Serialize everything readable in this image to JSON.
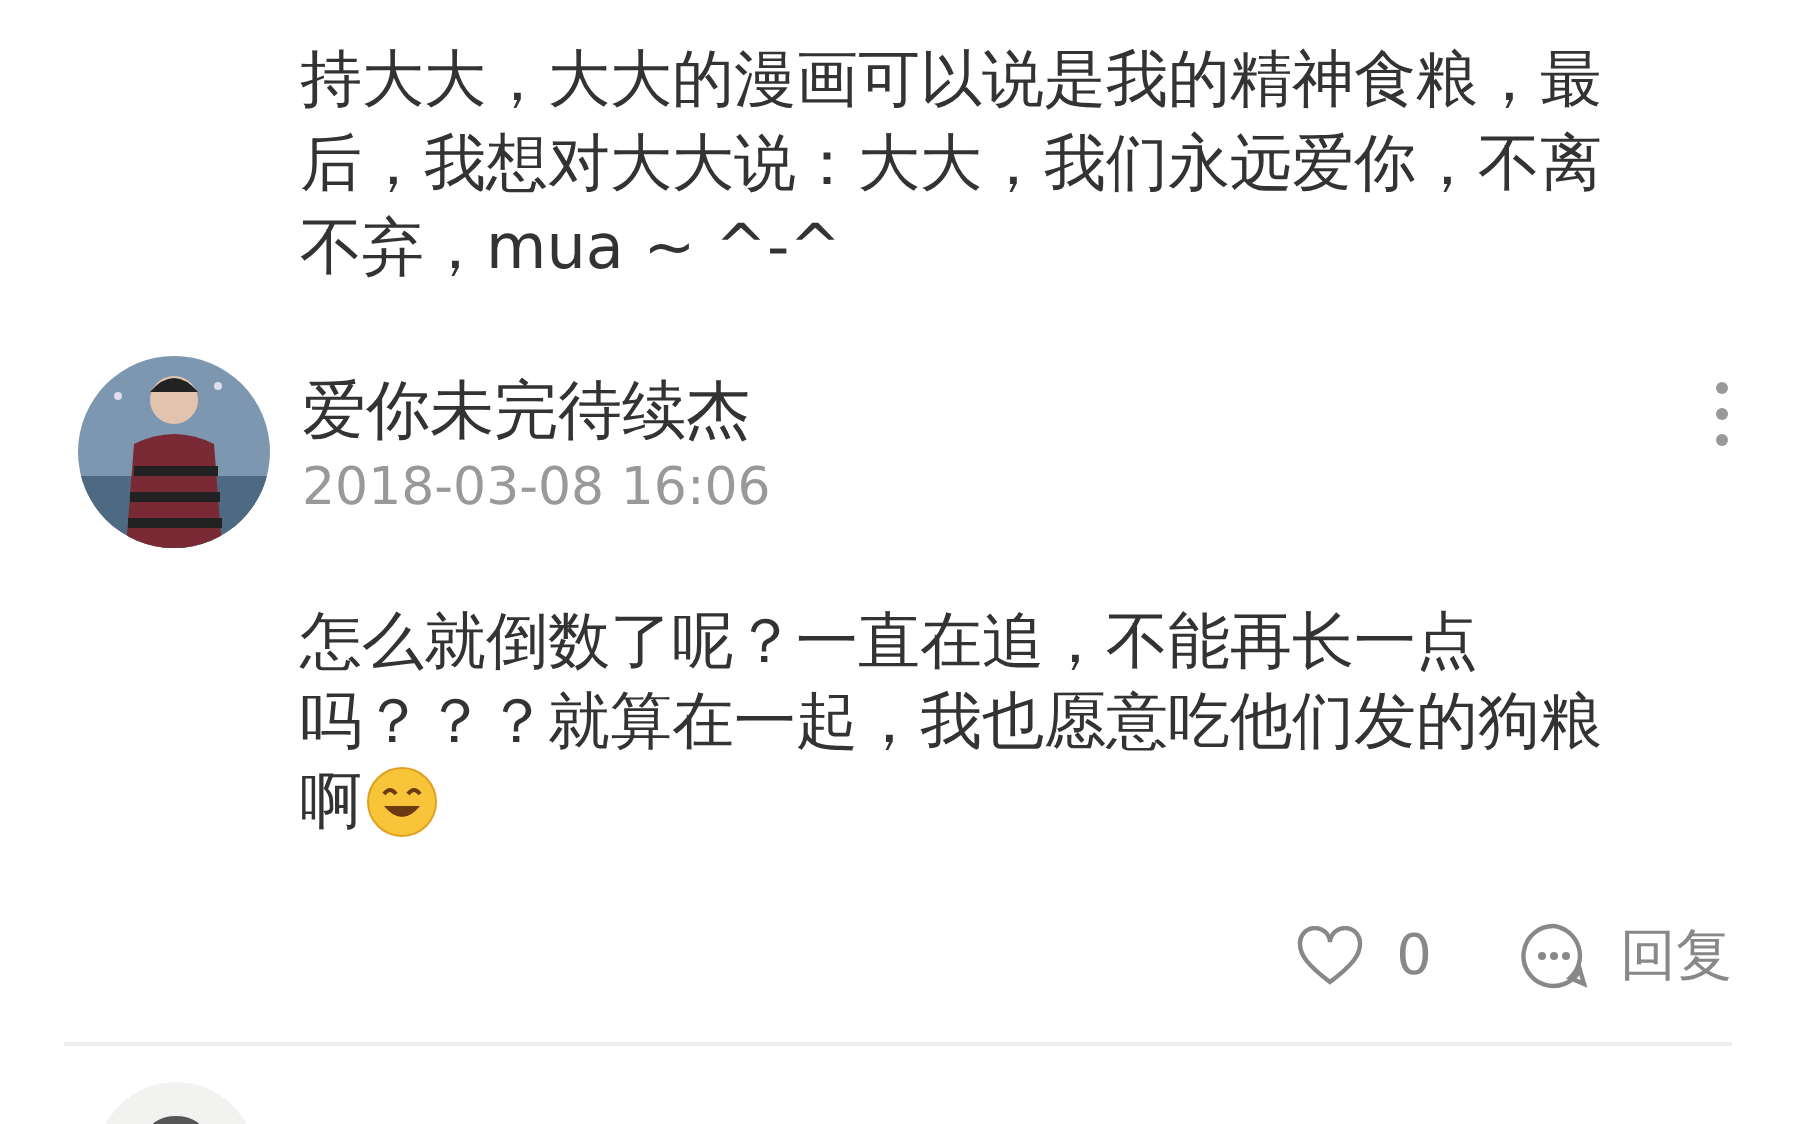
{
  "comments": [
    {
      "kind": "body_only",
      "lines": [
        "持大大，大大的漫画可以说是我的精神食粮，最",
        "后，我想对大大说：大大，我们永远爱你，不离",
        "不弃，mua ~ ^-^"
      ]
    },
    {
      "kind": "full",
      "author": "爱你未完待续杰",
      "time": "2018-03-08 16:06",
      "lines": [
        "怎么就倒数了呢？一直在追，不能再长一点",
        "吗？？？就算在一起，我也愿意吃他们发的狗粮",
        "啊"
      ],
      "emoji_after": true,
      "likes": "0",
      "reply_label": "回复"
    },
    {
      "kind": "cut_off"
    }
  ]
}
